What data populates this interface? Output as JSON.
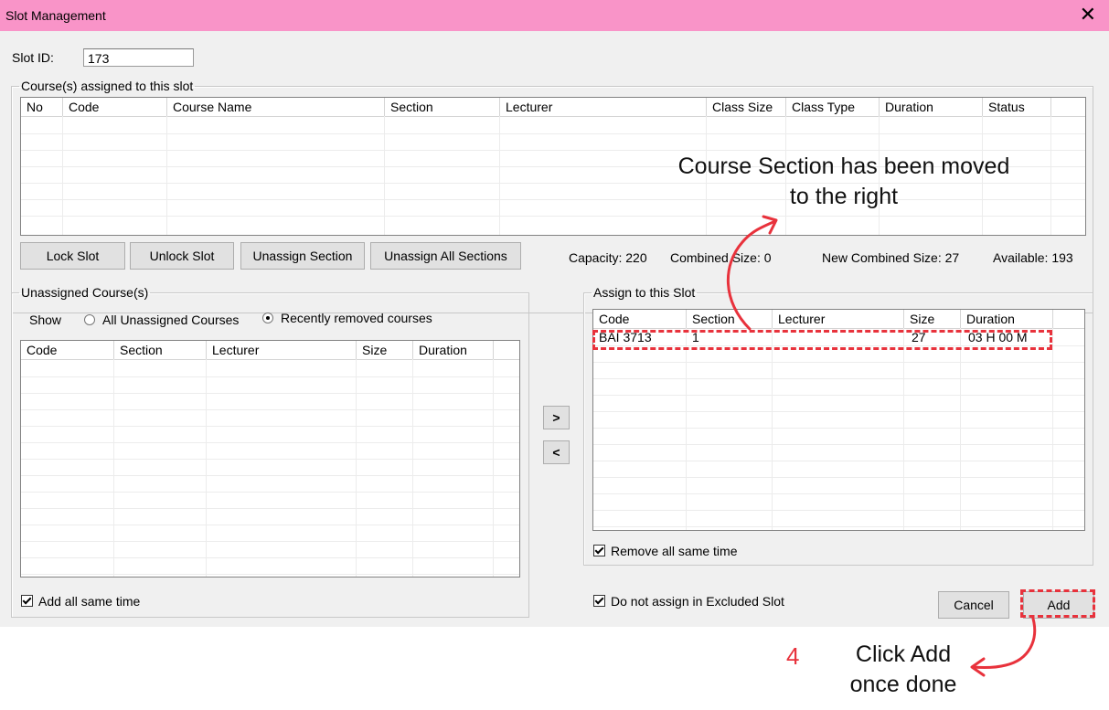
{
  "window": {
    "title": "Slot Management",
    "close_glyph": "✕"
  },
  "slot": {
    "label": "Slot ID:",
    "value": "173"
  },
  "assigned_group": {
    "legend": "Course(s) assigned to this slot",
    "columns": [
      "No",
      "Code",
      "Course Name",
      "Section",
      "Lecturer",
      "Class Size",
      "Class Type",
      "Duration",
      "Status"
    ]
  },
  "buttons": {
    "lock": "Lock Slot",
    "unlock": "Unlock Slot",
    "unassign": "Unassign Section",
    "unassign_all": "Unassign All Sections",
    "move_right": ">",
    "move_left": "<",
    "cancel": "Cancel",
    "add": "Add"
  },
  "stats": {
    "capacity": "Capacity: 220",
    "combined": "Combined Size:  0",
    "new_combined": "New Combined Size:  27",
    "available": "Available: 193"
  },
  "unassigned_group": {
    "legend": "Unassigned Course(s)",
    "show_label": "Show",
    "radio_all": "All Unassigned Courses",
    "radio_recent": "Recently removed courses",
    "columns": [
      "Code",
      "Section",
      "Lecturer",
      "Size",
      "Duration"
    ],
    "add_all_same_time": "Add all same time"
  },
  "assign_group": {
    "legend": "Assign to this Slot",
    "columns": [
      "Code",
      "Section",
      "Lecturer",
      "Size",
      "Duration"
    ],
    "rows": [
      {
        "code": "BAI 3713",
        "section": "1",
        "lecturer": "",
        "size": "27",
        "duration": "03 H 00 M"
      }
    ],
    "remove_all_same_time": "Remove all same time"
  },
  "exclude_checkbox": "Do not assign in Excluded Slot",
  "annotations": {
    "moved_line1": "Course Section has been moved",
    "moved_line2": "to the right",
    "step_number": "4",
    "click_add_line1": "Click Add",
    "click_add_line2": "once done"
  },
  "colors": {
    "titlebar": "#f994c8",
    "annotation_red": "#e8323c"
  }
}
